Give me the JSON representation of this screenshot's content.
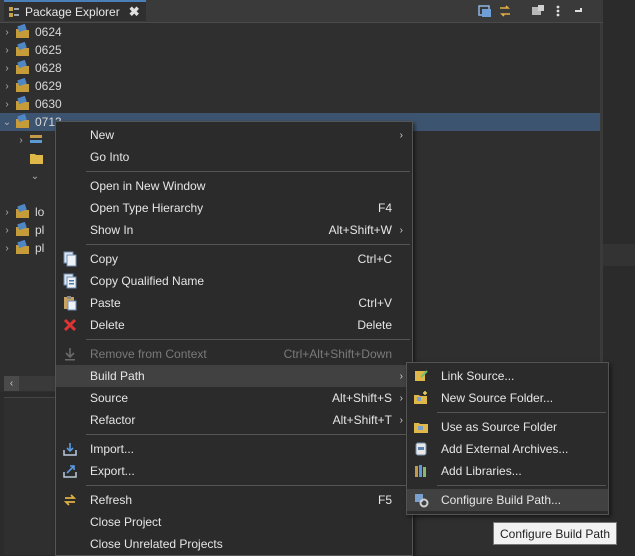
{
  "view": {
    "tab_title": "Package Explorer",
    "close_glyph": "✖",
    "toolbar_icons": [
      "collapse-all-icon",
      "link-with-editor-icon",
      "filters-icon",
      "view-menu-icon",
      "minimize-icon"
    ]
  },
  "tree": {
    "projects": [
      {
        "label": "0624",
        "arrow": "›"
      },
      {
        "label": "0625",
        "arrow": "›"
      },
      {
        "label": "0628",
        "arrow": "›"
      },
      {
        "label": "0629",
        "arrow": "›"
      },
      {
        "label": "0630",
        "arrow": "›"
      },
      {
        "label": "0713",
        "arrow": "⌄"
      }
    ],
    "children_partial": [
      {
        "label": "",
        "arrow": "›"
      },
      {
        "label": "",
        "arrow": ""
      },
      {
        "label": "",
        "arrow": "⌄"
      }
    ],
    "projects_after": [
      {
        "label": "lo",
        "arrow": "›"
      },
      {
        "label": "pl",
        "arrow": "›"
      },
      {
        "label": "pl",
        "arrow": "›"
      }
    ]
  },
  "hscroll": {
    "left_arrow": "‹"
  },
  "context_menu": {
    "items": [
      {
        "label": "New",
        "accel": "",
        "submenu": true,
        "icon": "",
        "disabled": false
      },
      {
        "label": "Go Into",
        "accel": "",
        "submenu": false,
        "icon": "",
        "disabled": false
      },
      {
        "label": "Open in New Window",
        "accel": "",
        "submenu": false,
        "icon": "",
        "disabled": false
      },
      {
        "label": "Open Type Hierarchy",
        "accel": "F4",
        "submenu": false,
        "icon": "",
        "disabled": false
      },
      {
        "label": "Show In",
        "accel": "Alt+Shift+W",
        "submenu": true,
        "icon": "",
        "disabled": false
      },
      {
        "label": "Copy",
        "accel": "Ctrl+C",
        "submenu": false,
        "icon": "copy-icon",
        "disabled": false
      },
      {
        "label": "Copy Qualified Name",
        "accel": "",
        "submenu": false,
        "icon": "copy-qualified-name-icon",
        "disabled": false
      },
      {
        "label": "Paste",
        "accel": "Ctrl+V",
        "submenu": false,
        "icon": "paste-icon",
        "disabled": false
      },
      {
        "label": "Delete",
        "accel": "Delete",
        "submenu": false,
        "icon": "delete-icon",
        "disabled": false
      },
      {
        "label": "Remove from Context",
        "accel": "Ctrl+Alt+Shift+Down",
        "submenu": false,
        "icon": "remove-context-icon",
        "disabled": true
      },
      {
        "label": "Build Path",
        "accel": "",
        "submenu": true,
        "icon": "",
        "disabled": false
      },
      {
        "label": "Source",
        "accel": "Alt+Shift+S",
        "submenu": true,
        "icon": "",
        "disabled": false
      },
      {
        "label": "Refactor",
        "accel": "Alt+Shift+T",
        "submenu": true,
        "icon": "",
        "disabled": false
      },
      {
        "label": "Import...",
        "accel": "",
        "submenu": false,
        "icon": "import-icon",
        "disabled": false
      },
      {
        "label": "Export...",
        "accel": "",
        "submenu": false,
        "icon": "export-icon",
        "disabled": false
      },
      {
        "label": "Refresh",
        "accel": "F5",
        "submenu": false,
        "icon": "refresh-icon",
        "disabled": false
      },
      {
        "label": "Close Project",
        "accel": "",
        "submenu": false,
        "icon": "",
        "disabled": false
      },
      {
        "label": "Close Unrelated Projects",
        "accel": "",
        "submenu": false,
        "icon": "",
        "disabled": false
      }
    ],
    "submenu_arrow": "›"
  },
  "build_path_menu": {
    "items": [
      {
        "label": "Link Source...",
        "icon": "link-source-icon"
      },
      {
        "label": "New Source Folder...",
        "icon": "new-source-folder-icon"
      },
      {
        "label": "Use as Source Folder",
        "icon": "use-as-source-folder-icon"
      },
      {
        "label": "Add External Archives...",
        "icon": "add-external-archives-icon"
      },
      {
        "label": "Add Libraries...",
        "icon": "add-libraries-icon"
      },
      {
        "label": "Configure Build Path...",
        "icon": "configure-build-path-icon"
      }
    ]
  },
  "tooltip": {
    "text": "Configure Build Path"
  },
  "colors": {
    "highlight": "#414141",
    "selection": "#3d5470",
    "tab_accent": "#4b7fb8"
  }
}
